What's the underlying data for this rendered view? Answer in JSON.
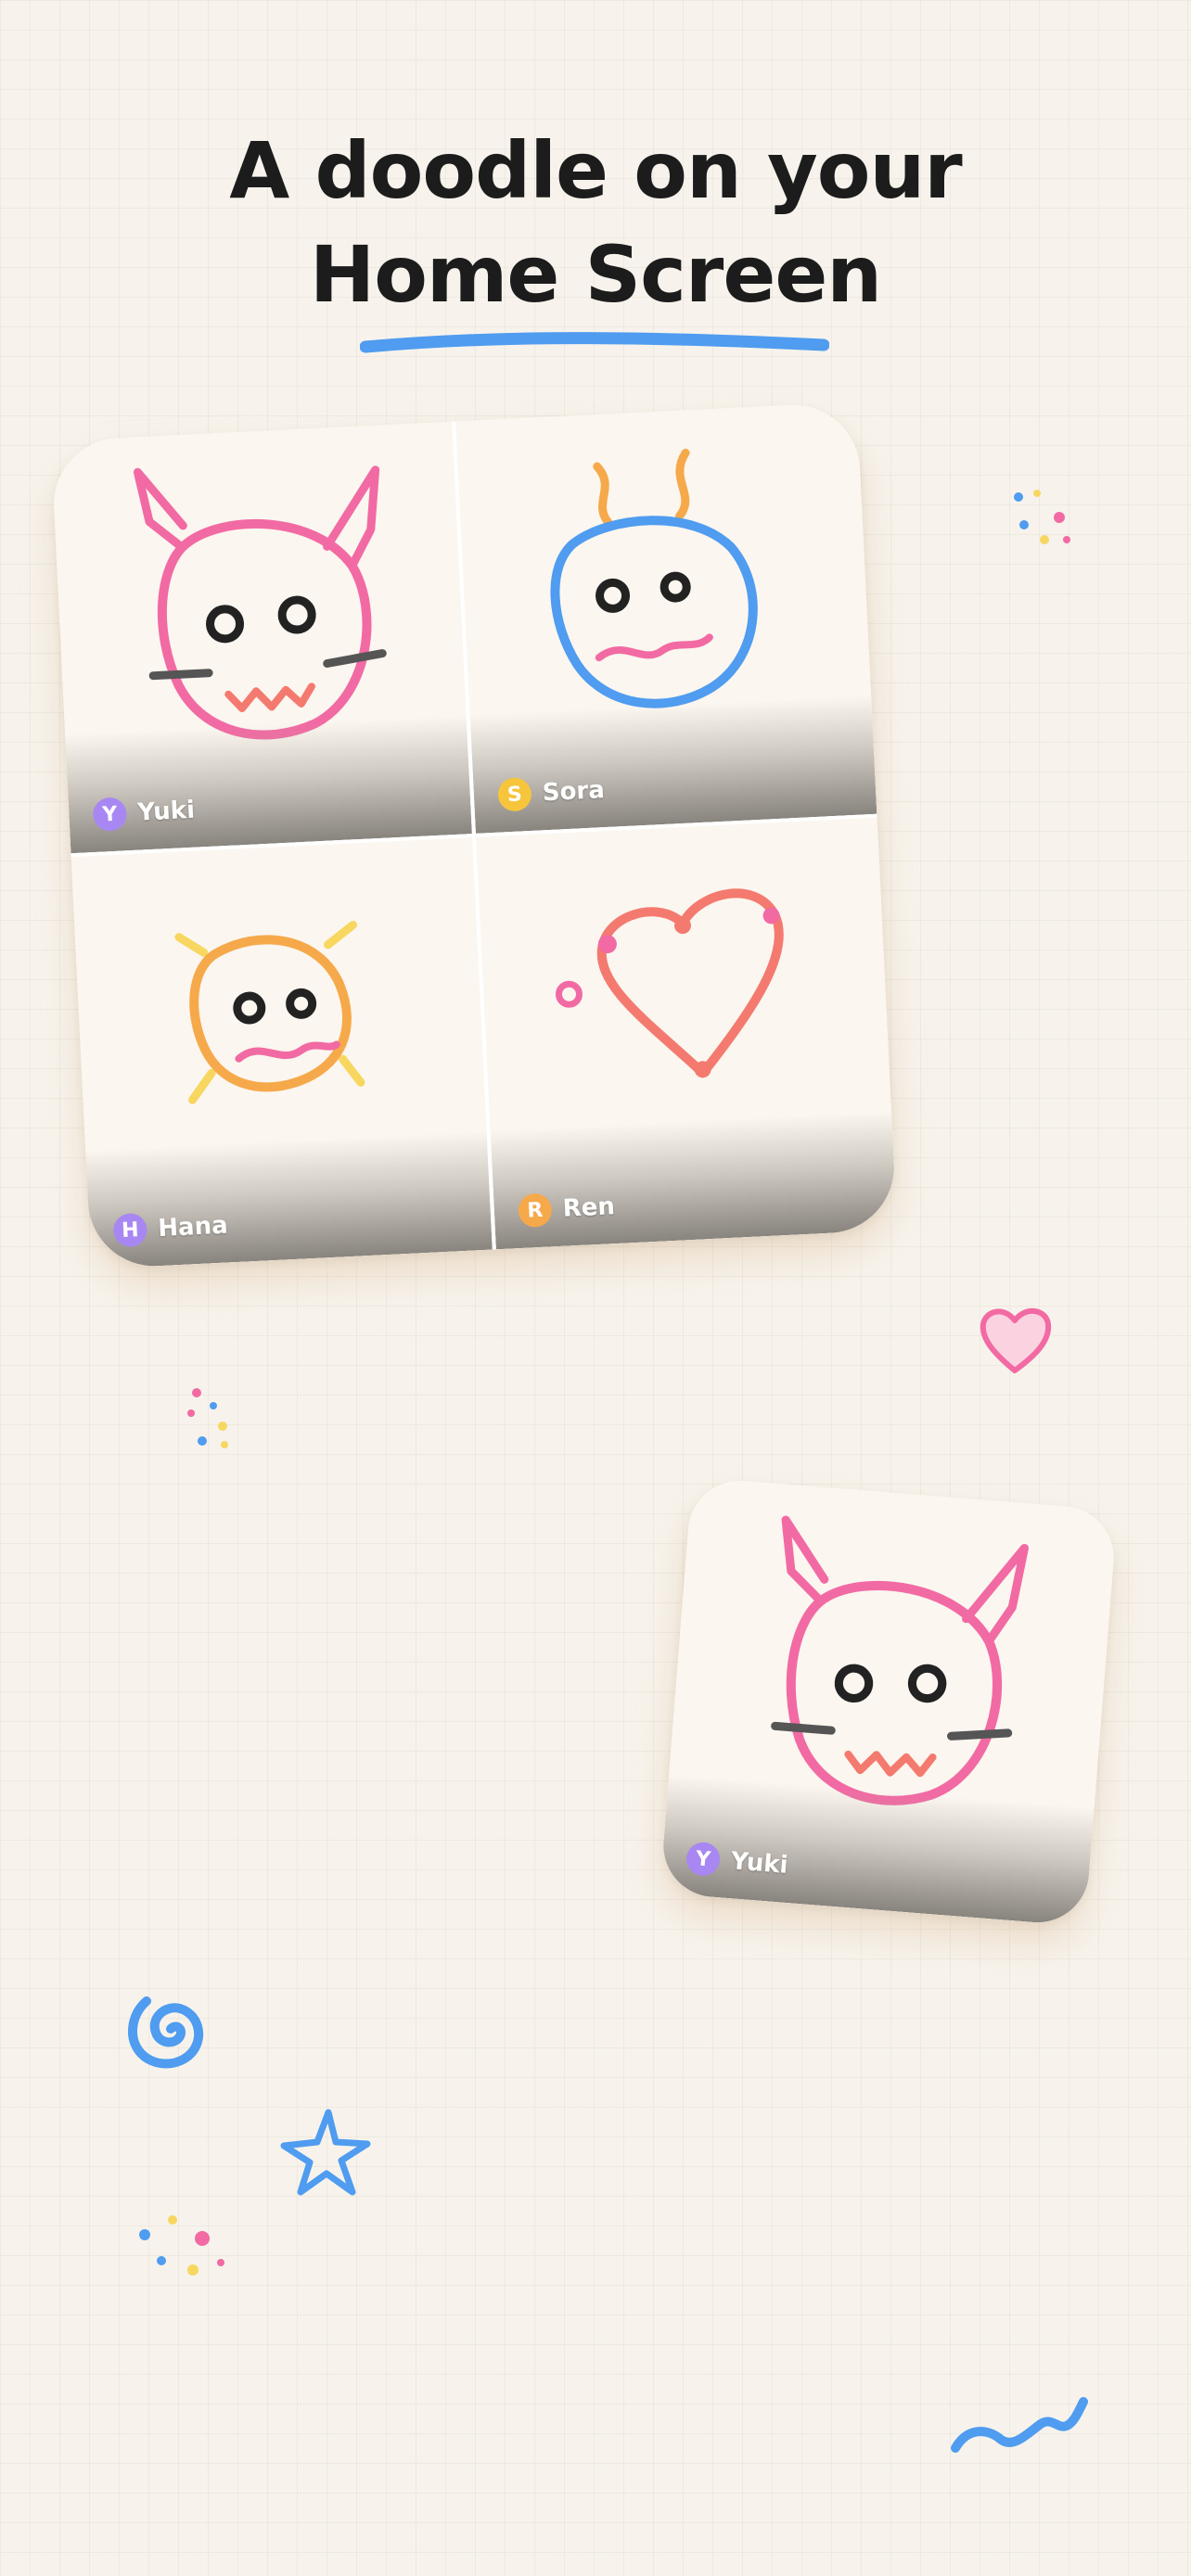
{
  "headline": {
    "line1": "A doodle on your",
    "line2": "Home Screen"
  },
  "colors": {
    "background": "#f7f3ec",
    "underline": "#4f9cf0",
    "pink": "#f26aa3",
    "blue": "#4f9cf0",
    "orange": "#f6a94a",
    "yellow": "#f7d760",
    "coral": "#f47a6f",
    "ink": "#222222"
  },
  "widget_large": {
    "tiles": [
      {
        "user": "Yuki",
        "initial": "Y",
        "avatar_color": "#a887f2",
        "doodle": "bunny-icon"
      },
      {
        "user": "Sora",
        "initial": "S",
        "avatar_color": "#f6c53c",
        "doodle": "bug-icon"
      },
      {
        "user": "Hana",
        "initial": "H",
        "avatar_color": "#a887f2",
        "doodle": "sun-icon"
      },
      {
        "user": "Ren",
        "initial": "R",
        "avatar_color": "#f6a94a",
        "doodle": "heart-icon"
      }
    ]
  },
  "widget_small": {
    "user": "Yuki",
    "initial": "Y",
    "avatar_color": "#a887f2",
    "doodle": "bunny-icon"
  },
  "decorations": [
    "confetti-dots-icon",
    "heart-icon",
    "spiral-icon",
    "star-icon",
    "squiggle-icon"
  ]
}
